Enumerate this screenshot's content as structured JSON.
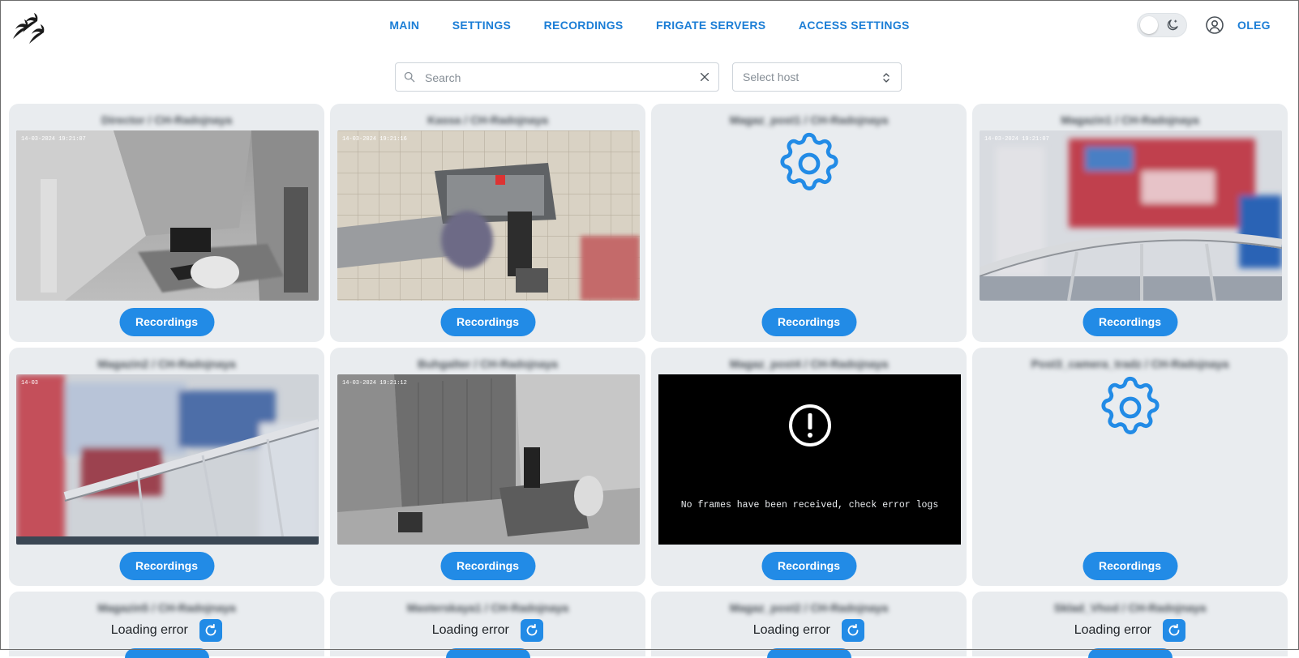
{
  "nav": {
    "items": [
      "MAIN",
      "SETTINGS",
      "RECORDINGS",
      "FRIGATE SERVERS",
      "ACCESS SETTINGS"
    ]
  },
  "user": {
    "name": "OLEG"
  },
  "theme_toggle": {
    "icon": "moon-icon",
    "state": "light"
  },
  "filters": {
    "search_placeholder": "Search",
    "host_placeholder": "Select host"
  },
  "colors": {
    "accent": "#228be6",
    "nav_link": "#1c7ed6",
    "card_bg": "#e9ecef"
  },
  "cameras": [
    {
      "title": "Director / CH-Radoјnaya",
      "state": "live",
      "recordings_label": "Recordings"
    },
    {
      "title": "Kassa / CH-Radoјnaya",
      "state": "live",
      "recordings_label": "Recordings"
    },
    {
      "title": "Magaz_post1 / CH-Radoјnaya",
      "state": "loading",
      "recordings_label": "Recordings"
    },
    {
      "title": "Magazin1 / CH-Radoјnaya",
      "state": "live",
      "recordings_label": "Recordings"
    },
    {
      "title": "Magazin2 / CH-Radoјnaya",
      "state": "live",
      "recordings_label": "Recordings"
    },
    {
      "title": "Buhgalter / CH-Radoјnaya",
      "state": "live",
      "recordings_label": "Recordings"
    },
    {
      "title": "Magaz_post4 / CH-Radoјnaya",
      "state": "no_frames",
      "recordings_label": "Recordings",
      "error_text": "No frames have been received, check error logs"
    },
    {
      "title": "Post3_camera_tradz / CH-Radoјnaya",
      "state": "loading",
      "recordings_label": "Recordings"
    },
    {
      "title": "Magazin5 / CH-Radoјnaya",
      "state": "error",
      "error_text": "Loading error"
    },
    {
      "title": "Masterskaya1 / CH-Radoјnaya",
      "state": "error",
      "error_text": "Loading error"
    },
    {
      "title": "Magaz_post2 / CH-Radoјnaya",
      "state": "error",
      "error_text": "Loading error"
    },
    {
      "title": "Sklad_Vhod / CH-Radoјnaya",
      "state": "error",
      "error_text": "Loading error"
    }
  ]
}
